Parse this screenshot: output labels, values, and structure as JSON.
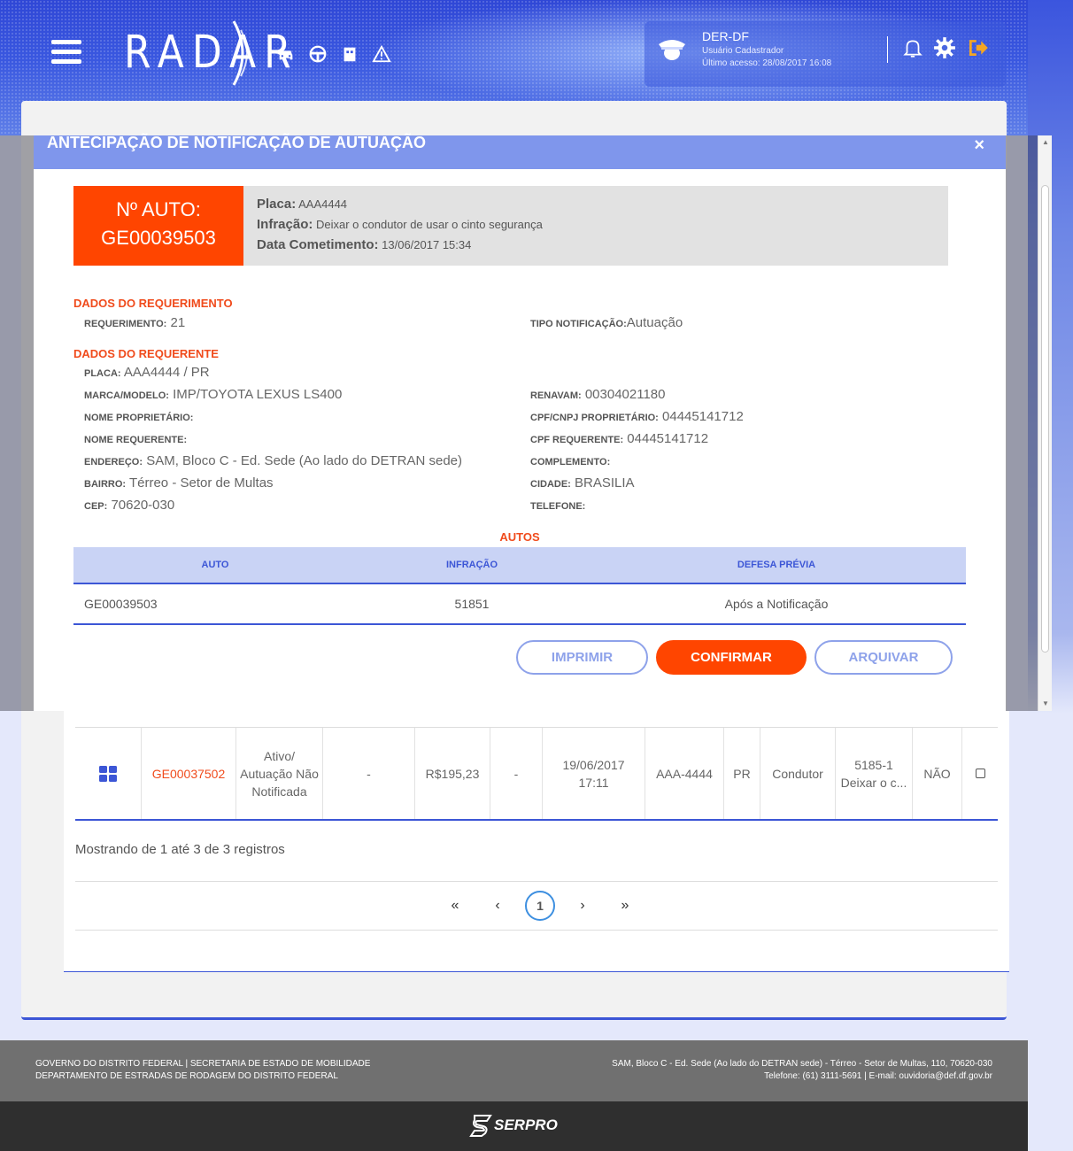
{
  "header": {
    "logo": "RADAR",
    "user_name": "DER-DF",
    "user_role": "Usuário Cadastrador",
    "last_access": "Último acesso: 28/08/2017 16:08"
  },
  "modal": {
    "title": "ANTECIPAÇÃO DE NOTIFICAÇÃO DE AUTUAÇÃO",
    "close": "×",
    "auto_label": "Nº AUTO:",
    "auto_number": "GE00039503",
    "placa_label": "Placa:",
    "placa": "AAA4444",
    "infracao_label": "Infração:",
    "infracao": "Deixar o condutor de usar o cinto segurança",
    "data_label": "Data Cometimento:",
    "data": "13/06/2017 15:34",
    "section_requerimento": "DADOS DO REQUERIMENTO",
    "requerimento_label": "REQUERIMENTO:",
    "requerimento": "21",
    "tipo_label": "TIPO NOTIFICAÇÃO:",
    "tipo": "Autuação",
    "section_requerente": "DADOS DO REQUERENTE",
    "fields_left": [
      {
        "label": "PLACA:",
        "value": "AAA4444 / PR"
      },
      {
        "label": "MARCA/MODELO:",
        "value": "IMP/TOYOTA LEXUS LS400"
      },
      {
        "label": "NOME PROPRIETÁRIO:",
        "value": ""
      },
      {
        "label": "NOME REQUERENTE:",
        "value": ""
      },
      {
        "label": "ENDEREÇO:",
        "value": "SAM, Bloco C - Ed. Sede (Ao lado do DETRAN sede)"
      },
      {
        "label": "BAIRRO:",
        "value": "Térreo - Setor de Multas"
      },
      {
        "label": "CEP:",
        "value": "70620-030"
      }
    ],
    "fields_right": [
      {
        "label": "RENAVAM:",
        "value": "00304021180"
      },
      {
        "label": "CPF/CNPJ PROPRIETÁRIO:",
        "value": "04445141712"
      },
      {
        "label": "CPF REQUERENTE:",
        "value": "04445141712"
      },
      {
        "label": "COMPLEMENTO:",
        "value": ""
      },
      {
        "label": "CIDADE:",
        "value": "BRASILIA"
      },
      {
        "label": "TELEFONE:",
        "value": ""
      }
    ],
    "autos_title": "AUTOS",
    "autos_headers": [
      "AUTO",
      "INFRAÇÃO",
      "DEFESA PRÉVIA"
    ],
    "autos_rows": [
      [
        "GE00039503",
        "51851",
        "Após a Notificação"
      ]
    ],
    "btn_imprimir": "IMPRIMIR",
    "btn_confirmar": "CONFIRMAR",
    "btn_arquivar": "ARQUIVAR"
  },
  "table": {
    "row": {
      "auto": "GE00037502",
      "status": "Ativo/ Autuação Não Notificada",
      "col3": "-",
      "valor": "R$195,23",
      "col5": "-",
      "data": "19/06/2017 17:11",
      "placa": "AAA-4444",
      "uf": "PR",
      "tipo": "Condutor",
      "infracao": "5185-1 Deixar o c...",
      "flag": "NÃO"
    },
    "info": "Mostrando de 1 até 3 de 3 registros",
    "pager": {
      "first": "«",
      "prev": "‹",
      "current": "1",
      "next": "›",
      "last": "»"
    }
  },
  "footer": {
    "left1": "GOVERNO DO DISTRITO FEDERAL | SECRETARIA DE ESTADO DE MOBILIDADE",
    "left2": "DEPARTAMENTO DE ESTRADAS DE RODAGEM DO DISTRITO FEDERAL",
    "right1": "SAM, Bloco C - Ed. Sede (Ao lado do DETRAN sede) - Térreo - Setor de Multas, 110, 70620-030",
    "right2": "Telefone: (61) 3111-5691 | E-mail: ouvidoria@def.df.gov.br",
    "brand": "SERPRO"
  },
  "colors": {
    "accent": "#ff4500",
    "primary": "#3c56d6",
    "modal_header": "#7f96ec"
  }
}
